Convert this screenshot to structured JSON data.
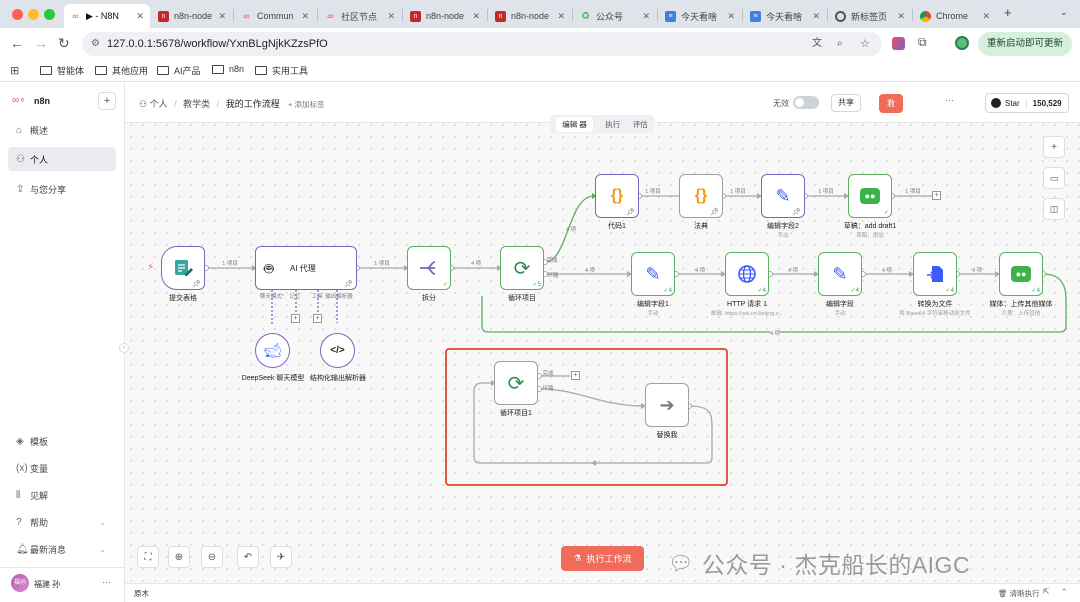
{
  "browser": {
    "tabs": [
      {
        "label": "▶ - N8N",
        "icon": "n8n-icon",
        "active": true
      },
      {
        "label": "n8n-node",
        "icon": "n-logo-icon"
      },
      {
        "label": "Commun",
        "icon": "n8n-icon"
      },
      {
        "label": "社区节点",
        "icon": "n8n-icon"
      },
      {
        "label": "n8n-node",
        "icon": "n-logo-icon"
      },
      {
        "label": "n8n-node",
        "icon": "n-logo-icon"
      },
      {
        "label": "公众号",
        "icon": "wechat-icon"
      },
      {
        "label": "今天看啥",
        "icon": "doc-icon"
      },
      {
        "label": "今天看啥",
        "icon": "doc-icon"
      },
      {
        "label": "新标签页",
        "icon": "globe-icon"
      },
      {
        "label": "Chrome",
        "icon": "chrome-icon"
      }
    ],
    "url": "127.0.0.1:5678/workflow/YxnBLgNjkKZzsPfO",
    "update_button": "重新启动即可更新",
    "bookmarks": [
      "智能体",
      "其他应用",
      "AI产品",
      "n8n",
      "实用工具"
    ]
  },
  "sidebar": {
    "brand": "n8n",
    "items": [
      {
        "label": "概述",
        "icon": "home-icon"
      },
      {
        "label": "个人",
        "icon": "user-icon",
        "active": true
      },
      {
        "label": "与您分享",
        "icon": "share-icon"
      }
    ],
    "bottom_items": [
      {
        "label": "模板",
        "icon": "template-icon"
      },
      {
        "label": "变量",
        "icon": "variable-icon"
      },
      {
        "label": "见解",
        "icon": "chart-icon"
      },
      {
        "label": "帮助",
        "icon": "help-icon"
      },
      {
        "label": "最新消息",
        "icon": "bell-icon"
      }
    ],
    "user_name": "福建 孙",
    "user_avatar": "福孙"
  },
  "header": {
    "breadcrumb": [
      "个人",
      "教学类",
      "我的工作流程"
    ],
    "add_tag": "+ 添加标签",
    "inactive_label": "无效",
    "share_button": "共享",
    "save_button": "救",
    "more": "···",
    "github_star": "Star",
    "star_count": "150,529",
    "tabs": [
      "编辑 器",
      "执行",
      "评估"
    ]
  },
  "nodes": [
    {
      "id": "form",
      "label": "提交表格",
      "sub": ""
    },
    {
      "id": "ai",
      "label": "AI 代理",
      "sub": ""
    },
    {
      "id": "split",
      "label": "拆分",
      "sub": ""
    },
    {
      "id": "loop",
      "label": "循环项目",
      "sub": ""
    },
    {
      "id": "code",
      "label": "代码1",
      "sub": ""
    },
    {
      "id": "law",
      "label": "法典",
      "sub": ""
    },
    {
      "id": "edit2",
      "label": "编辑字段2",
      "sub": "手动"
    },
    {
      "id": "draft",
      "label": "草稿：add draft1",
      "sub": "草稿：添加"
    },
    {
      "id": "edit1",
      "label": "编辑字段1",
      "sub": "手动"
    },
    {
      "id": "http",
      "label": "HTTP 请求 1",
      "sub": "邮政: https://ark.cn-beijing.v..."
    },
    {
      "id": "edit",
      "label": "编辑字段",
      "sub": "手动"
    },
    {
      "id": "convert",
      "label": "转换为文件",
      "sub": "将 Base64 字符串移动到文件"
    },
    {
      "id": "media",
      "label": "媒体：上传其他媒体",
      "sub": "介质：上传其他"
    },
    {
      "id": "deepseek",
      "label": "DeepSeek 聊天模型",
      "sub": ""
    },
    {
      "id": "parser",
      "label": "结构化输出解析器",
      "sub": ""
    },
    {
      "id": "loop1",
      "label": "循环项目1",
      "sub": ""
    },
    {
      "id": "replace",
      "label": "替换我",
      "sub": ""
    }
  ],
  "edge_labels": {
    "one_item": "1 项目",
    "four_items": "4 项",
    "done": "完成",
    "loop": "环路",
    "four": "4 项",
    "chat_model": "聊天模式*",
    "memory": "记忆",
    "tool": "工具",
    "output_parser": "输出解析器"
  },
  "node_badges": {
    "five": "5",
    "four": "4"
  },
  "footer": {
    "execute_button": "执行工作流",
    "log_label": "原木",
    "clear_execution": "清晰执行",
    "watermark": "公众号 · 杰克船长的AIGC"
  },
  "colors": {
    "accent": "#ea4b71",
    "execute": "#f06b5a",
    "green_edge": "#5fae5f",
    "purple_node": "#7b64c0",
    "highlight_box": "#e0442f"
  }
}
